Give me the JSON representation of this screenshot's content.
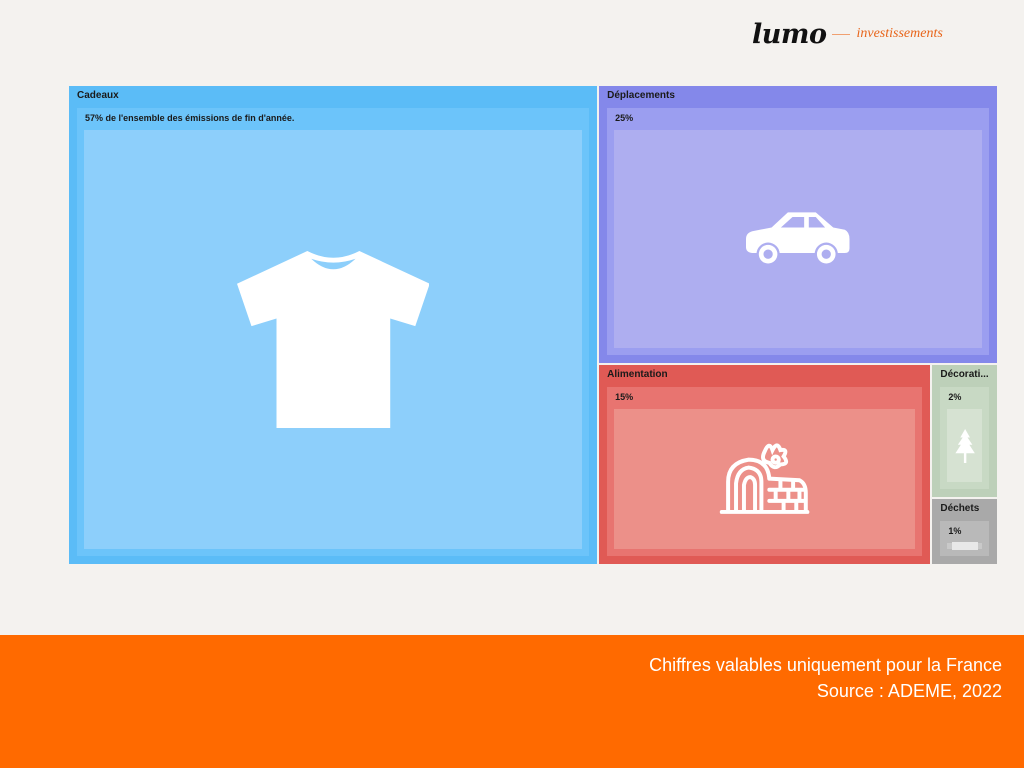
{
  "logo": {
    "name": "lumo",
    "sub": "investissements"
  },
  "chart_data": {
    "type": "treemap",
    "items": [
      {
        "name": "Cadeaux",
        "value": 57,
        "label": "57% de l'ensemble des émissions de fin d'année.",
        "icon": "tshirt-icon",
        "color": "#5bbcf7",
        "inner": "#6cc4fa",
        "core": "#8dcffb"
      },
      {
        "name": "Déplacements",
        "value": 25,
        "label": "25%",
        "icon": "car-icon",
        "color": "#8488ea",
        "inner": "#9b9ef0",
        "core": "#aeaef0"
      },
      {
        "name": "Alimentation",
        "value": 15,
        "label": "15%",
        "icon": "yule-log-icon",
        "color": "#e05a55",
        "inner": "#e87470",
        "core": "#ec9089"
      },
      {
        "name": "Décorati...",
        "value": 2,
        "label": "2%",
        "icon": "tree-icon",
        "color": "#bdd0b9",
        "inner": "#c8d9c4",
        "core": "#d6e2d2"
      },
      {
        "name": "Déchets",
        "value": 1,
        "label": "1%",
        "icon": "bar-icon",
        "color": "#a9a9a9",
        "inner": "#b9b9b9",
        "core": "#c9c9c9"
      }
    ]
  },
  "footer": {
    "line1": "Chiffres valables uniquement pour la France",
    "line2": "Source : ADEME, 2022"
  }
}
